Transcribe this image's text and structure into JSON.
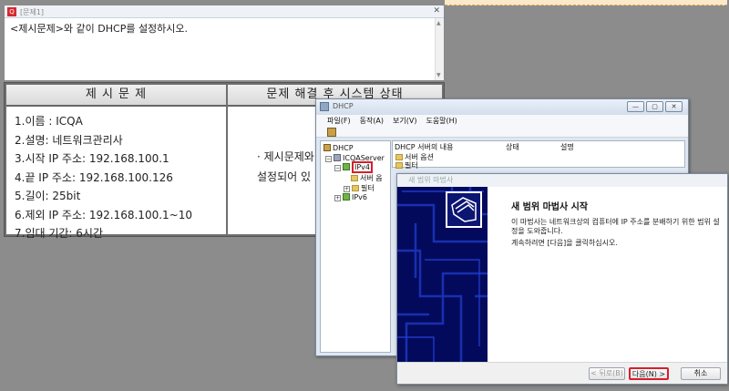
{
  "question_window": {
    "title": "[문제1]",
    "instruction": "<제시문제>와 같이 DHCP를 설정하시오."
  },
  "problem": {
    "left_header": "제 시 문 제",
    "right_header": "문제 해결 후 시스템 상태",
    "items": [
      "1.이름 : ICQA",
      "2.설명: 네트워크관리사",
      "3.시작 IP 주소: 192.168.100.1",
      "4.끝 IP 주소: 192.168.100.126",
      "5.길이: 25bit",
      "6.제외 IP 주소: 192.168.100.1~10",
      "7.임대 기간: 6시간"
    ],
    "right_line1": "· 제시문제와",
    "right_line2": "설정되어 있"
  },
  "dhcp_window": {
    "title": "DHCP",
    "menu": [
      "파일(F)",
      "동작(A)",
      "보기(V)",
      "도움말(H)"
    ],
    "tree": {
      "root": "DHCP",
      "server": "ICQAServer",
      "ipv4": "IPv4",
      "server_options": "서버 옵",
      "filters": "필터",
      "ipv6": "IPv6"
    },
    "detail": {
      "columns": [
        "DHCP 서버의 내용",
        "상태",
        "설명"
      ],
      "rows": [
        "서버 옵션",
        "필터"
      ]
    }
  },
  "wizard": {
    "title": "새 범위 마법사",
    "heading": "새 범위 마법사 시작",
    "description": "이 마법사는 네트워크상의 컴퓨터에 IP 주소를 분배하기 위한 범위 설정을 도와줍니다.",
    "continue_text": "계속하려면 [다음]을 클릭하십시오.",
    "back_label": "< 뒤로(B)",
    "next_label": "다음(N) >",
    "cancel_label": "취소"
  },
  "colors": {
    "highlight_red": "#d81e2a",
    "wizard_side": "#030a5c",
    "background": "#8c8c8c"
  }
}
